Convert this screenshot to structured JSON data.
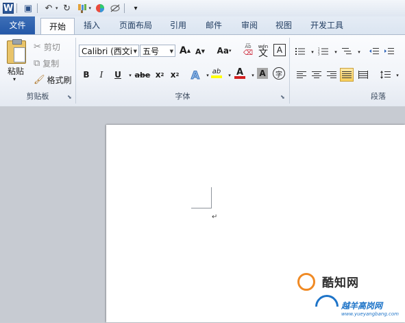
{
  "app": {
    "logo_letter": "W"
  },
  "qat": {
    "icons": [
      "word-icon",
      "save-icon",
      "undo-icon",
      "redo-icon",
      "format-painter-icon",
      "color-icon",
      "draw-icon",
      "customize-icon"
    ],
    "undo_glyph": "↶",
    "redo_glyph": "↻",
    "save_glyph": "▣",
    "customize_glyph": "▾"
  },
  "tabs": {
    "file": "文件",
    "home": "开始",
    "insert": "插入",
    "page_layout": "页面布局",
    "references": "引用",
    "mailings": "邮件",
    "review": "审阅",
    "view": "视图",
    "developer": "开发工具"
  },
  "clipboard": {
    "paste": "粘贴",
    "cut": "剪切",
    "copy": "复制",
    "format_painter": "格式刷",
    "group_label": "剪贴板"
  },
  "font": {
    "font_name": "Calibri (西文i",
    "font_size": "五号",
    "grow": "A",
    "shrink": "A",
    "change_case": "Aa",
    "bold": "B",
    "italic": "I",
    "underline": "U",
    "strike": "abe",
    "subscript": "x",
    "superscript": "x",
    "sub_mark": "2",
    "sup_mark": "2",
    "highlight": "ab",
    "font_color": "A",
    "char_shading": "A",
    "enclose": "字",
    "phonetic": "文",
    "phonetic_top": "wén",
    "border_char": "A",
    "group_label": "字体"
  },
  "paragraph": {
    "group_label": "段落"
  },
  "document": {
    "paragraph_mark": "↵"
  },
  "watermark": {
    "brand": "酷知网",
    "site_cn": "越羊高岗网",
    "url": "www.yueyangbang.com"
  },
  "colors": {
    "file_tab": "#2b5ba8",
    "highlight_yellow": "#ffff00",
    "font_color_red": "#d21f1f",
    "selected_orange": "#f8cf5a"
  }
}
